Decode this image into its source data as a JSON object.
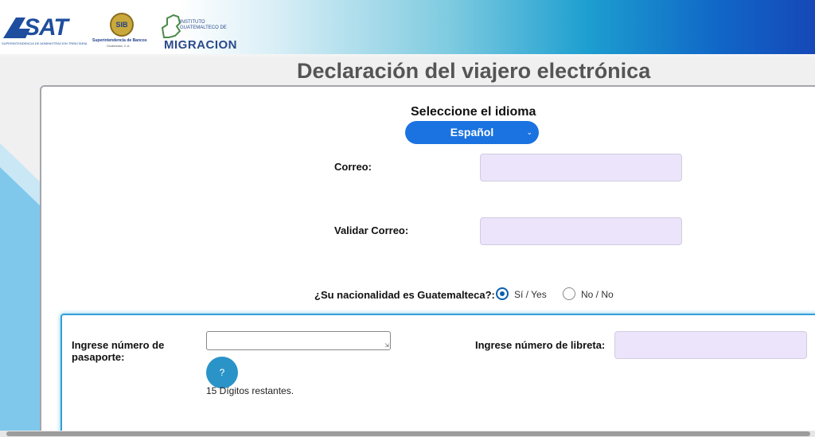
{
  "header": {
    "sat_logo": {
      "name": "SAT",
      "subtitle": "SUPERINTENDENCIA DE ADMINISTRACION TRIBUTARIA"
    },
    "sib_logo": {
      "seal": "SIB",
      "name": "Superintendencia de Bancos",
      "subtitle": "Guatemala, C.A."
    },
    "migracion_logo": {
      "line1": "INSTITUTO",
      "line2": "GUATEMALTECO DE",
      "name": "MIGRACION"
    }
  },
  "page": {
    "title": "Declaración del viajero electrónica"
  },
  "language": {
    "label": "Seleccione el idioma",
    "selected": "Español"
  },
  "form": {
    "email_label": "Correo:",
    "email_value": "",
    "validate_email_label": "Validar Correo:",
    "validate_email_value": "",
    "nationality_question": "¿Su nacionalidad es Guatemalteca?:",
    "nationality_options": [
      {
        "label": "Sí / Yes",
        "selected": true
      },
      {
        "label": "No / No",
        "selected": false
      }
    ]
  },
  "passport": {
    "label_line1": "Ingrese número de",
    "label_line2": "pasaporte:",
    "value": "",
    "help_label": "?",
    "digits_remaining": "15 Dígitos restantes.",
    "booklet_label": "Ingrese número de libreta:",
    "booklet_value": ""
  },
  "colors": {
    "accent_blue": "#1a73e0",
    "field_fill": "#ece4fb",
    "subpanel_border": "#2fa0d8",
    "title_gray": "#555555"
  },
  "icons": [
    "chevron-down-icon",
    "textarea-resize-icon",
    "help-icon"
  ]
}
